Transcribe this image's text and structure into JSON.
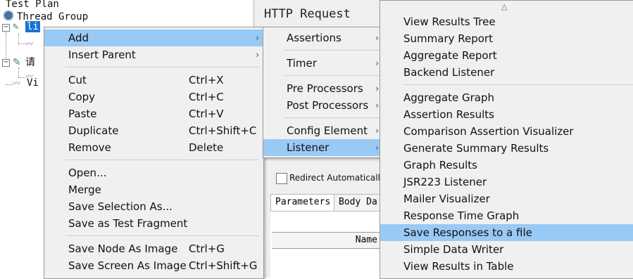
{
  "tree": {
    "items": [
      {
        "label": "Test Plan"
      },
      {
        "label": "Thread Group"
      },
      {
        "label": "li"
      },
      {
        "label": "请"
      },
      {
        "label": "Vi"
      }
    ]
  },
  "http_panel": {
    "title": "HTTP Request",
    "redirect_label": "Redirect Automatically",
    "tabs": [
      "Parameters",
      "Body Da"
    ],
    "table_header": "Name"
  },
  "context_menu": {
    "items": [
      {
        "label": "Add",
        "has_submenu": true,
        "highlighted": true
      },
      {
        "label": "Insert Parent",
        "has_submenu": true
      },
      {
        "label": "Cut",
        "shortcut": "Ctrl+X"
      },
      {
        "label": "Copy",
        "shortcut": "Ctrl+C"
      },
      {
        "label": "Paste",
        "shortcut": "Ctrl+V"
      },
      {
        "label": "Duplicate",
        "shortcut": "Ctrl+Shift+C"
      },
      {
        "label": "Remove",
        "shortcut": "Delete"
      },
      {
        "label": "Open..."
      },
      {
        "label": "Merge"
      },
      {
        "label": "Save Selection As..."
      },
      {
        "label": "Save as Test Fragment"
      },
      {
        "label": "Save Node As Image",
        "shortcut": "Ctrl+G"
      },
      {
        "label": "Save Screen As Image",
        "shortcut": "Ctrl+Shift+G"
      }
    ]
  },
  "add_submenu": {
    "items": [
      {
        "label": "Assertions"
      },
      {
        "label": "Timer"
      },
      {
        "label": "Pre Processors"
      },
      {
        "label": "Post Processors"
      },
      {
        "label": "Config Element"
      },
      {
        "label": "Listener",
        "highlighted": true
      }
    ]
  },
  "listener_submenu": {
    "items": [
      {
        "label": "View Results Tree"
      },
      {
        "label": "Summary Report"
      },
      {
        "label": "Aggregate Report"
      },
      {
        "label": "Backend Listener"
      },
      {
        "label": "Aggregate Graph"
      },
      {
        "label": "Assertion Results"
      },
      {
        "label": "Comparison Assertion Visualizer"
      },
      {
        "label": "Generate Summary Results"
      },
      {
        "label": "Graph Results"
      },
      {
        "label": "JSR223 Listener"
      },
      {
        "label": "Mailer Visualizer"
      },
      {
        "label": "Response Time Graph"
      },
      {
        "label": "Save Responses to a file",
        "highlighted": true
      },
      {
        "label": "Simple Data Writer"
      },
      {
        "label": "View Results in Table"
      }
    ]
  },
  "colors": {
    "menu_highlight": "#99c9f5",
    "tree_selection": "#1a73d1",
    "menu_background": "#f0f0f0"
  }
}
